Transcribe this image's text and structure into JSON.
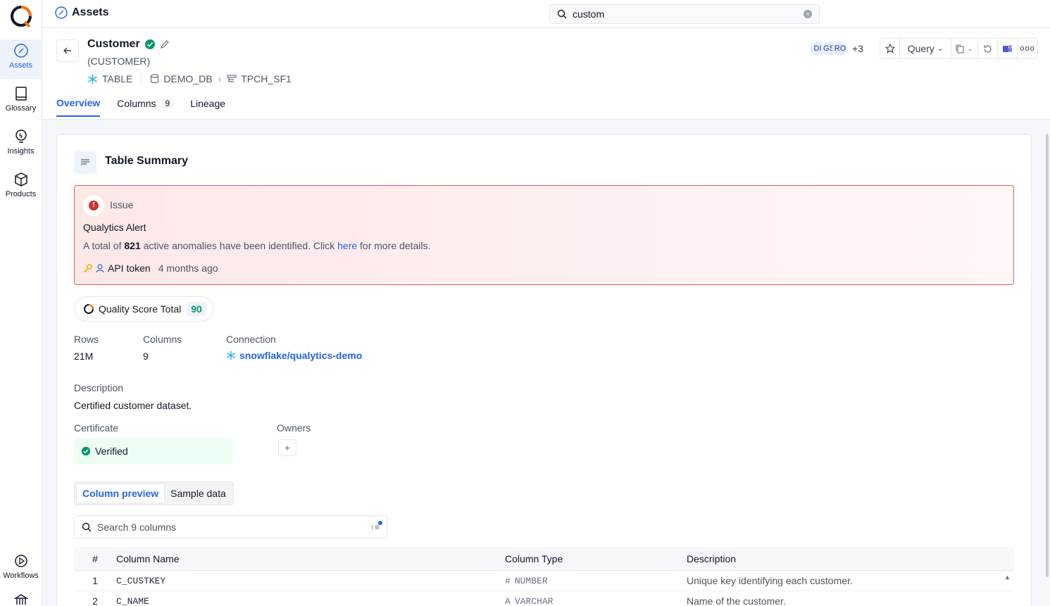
{
  "nav": {
    "items": [
      {
        "label": "Assets",
        "icon": "compass-icon",
        "active": true
      },
      {
        "label": "Glossary",
        "icon": "book-icon"
      },
      {
        "label": "Insights",
        "icon": "lightbulb-icon"
      },
      {
        "label": "Products",
        "icon": "cube-icon"
      },
      {
        "label": "Workflows",
        "icon": "play-icon"
      }
    ]
  },
  "topbar": {
    "section": "Assets",
    "search_value": "custom"
  },
  "asset": {
    "name": "Customer",
    "qualified_name": "(CUSTOMER)",
    "type_label": "TABLE",
    "database": "DEMO_DB",
    "schema": "TPCH_SF1"
  },
  "owners_header": {
    "avatars": [
      "DI",
      "GS",
      "RO"
    ],
    "more": "+3"
  },
  "actions": {
    "query_label": "Query"
  },
  "tabs": [
    {
      "label": "Overview",
      "active": true
    },
    {
      "label": "Columns",
      "count": "9"
    },
    {
      "label": "Lineage"
    }
  ],
  "summary": {
    "title": "Table Summary",
    "issue": {
      "label": "Issue",
      "title": "Qualytics Alert",
      "text_prefix": "A total of",
      "count": "821",
      "text_middle": "active anomalies have been identified. Click",
      "link": "here",
      "text_suffix": "for more details.",
      "author": "API token",
      "time": "4 months ago"
    },
    "quality_score": {
      "label": "Quality Score Total",
      "value": "90"
    },
    "rows_label": "Rows",
    "rows_value": "21M",
    "columns_label": "Columns",
    "columns_value": "9",
    "connection_label": "Connection",
    "connection_value": "snowflake/qualytics-demo",
    "description_label": "Description",
    "description_value": "Certified customer dataset.",
    "certificate_label": "Certificate",
    "certificate_value": "Verified",
    "owners_label": "Owners"
  },
  "preview": {
    "tab_column": "Column preview",
    "tab_sample": "Sample data",
    "search_placeholder": "Search 9 columns",
    "headers": {
      "num": "#",
      "name": "Column Name",
      "type": "Column Type",
      "description": "Description"
    },
    "rows": [
      {
        "num": "1",
        "name": "C_CUSTKEY",
        "type_icon": "#",
        "type": "NUMBER",
        "description": "Unique key identifying each customer."
      },
      {
        "num": "2",
        "name": "C_NAME",
        "type_icon": "A",
        "type": "VARCHAR",
        "description": "Name of the customer."
      }
    ]
  },
  "colors": {
    "accent": "#2563eb",
    "alert_border": "#e45a5a",
    "verified": "#059669"
  }
}
